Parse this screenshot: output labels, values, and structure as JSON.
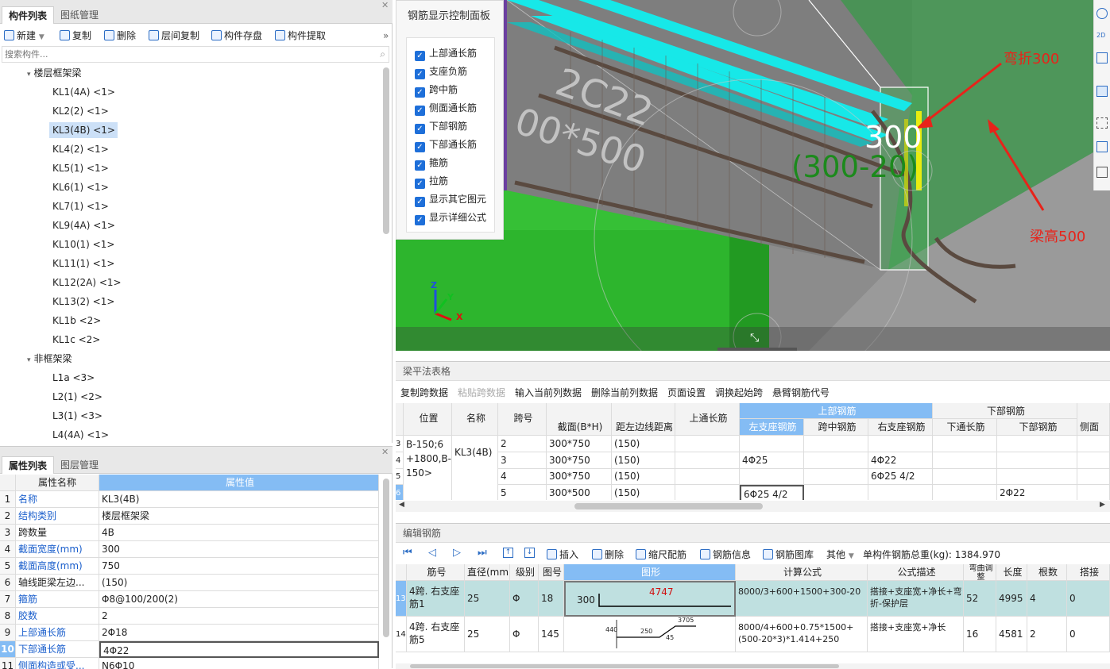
{
  "left_top": {
    "tabs": [
      "构件列表",
      "图纸管理"
    ],
    "toolbar": [
      "新建",
      "复制",
      "删除",
      "层间复制",
      "构件存盘",
      "构件提取"
    ],
    "search_placeholder": "搜索构件...",
    "group1": "楼层框架梁",
    "items1": [
      "KL1(4A) <1>",
      "KL2(2) <1>",
      "KL3(4B) <1>",
      "KL4(2) <1>",
      "KL5(1) <1>",
      "KL6(1) <1>",
      "KL7(1) <1>",
      "KL9(4A) <1>",
      "KL10(1) <1>",
      "KL11(1) <1>",
      "KL12(2A) <1>",
      "KL13(2) <1>",
      "KL1b <2>",
      "KL1c <2>"
    ],
    "group2": "非框架梁",
    "items2": [
      "L1a <3>",
      "L2(1) <2>",
      "L3(1) <3>",
      "L4(4A) <1>"
    ]
  },
  "left_bottom": {
    "tabs": [
      "属性列表",
      "图层管理"
    ],
    "col_name": "属性名称",
    "col_value": "属性值",
    "rows": [
      {
        "n": "1",
        "name": "名称",
        "value": "KL3(4B)",
        "blue": true
      },
      {
        "n": "2",
        "name": "结构类别",
        "value": "楼层框架梁",
        "blue": true
      },
      {
        "n": "3",
        "name": "跨数量",
        "value": "4B",
        "blue": false
      },
      {
        "n": "4",
        "name": "截面宽度(mm)",
        "value": "300",
        "blue": true
      },
      {
        "n": "5",
        "name": "截面高度(mm)",
        "value": "750",
        "blue": true
      },
      {
        "n": "6",
        "name": "轴线距梁左边...",
        "value": "(150)",
        "blue": false
      },
      {
        "n": "7",
        "name": "箍筋",
        "value": "Φ8@100/200(2)",
        "blue": true
      },
      {
        "n": "8",
        "name": "胶数",
        "value": "2",
        "blue": true
      },
      {
        "n": "9",
        "name": "上部通长筋",
        "value": "2Φ18",
        "blue": true
      },
      {
        "n": "10",
        "name": "下部通长筋",
        "value": "4Φ22",
        "blue": true
      },
      {
        "n": "11",
        "name": "侧面构造或受...",
        "value": "N6Φ10",
        "blue": true
      }
    ]
  },
  "panel": {
    "title": "钢筋显示控制面板",
    "checks": [
      "上部通长筋",
      "支座负筋",
      "跨中筋",
      "侧面通长筋",
      "下部钢筋",
      "下部通长筋",
      "箍筋",
      "拉筋",
      "显示其它图元",
      "显示详细公式"
    ]
  },
  "viewport": {
    "annotation_bend": "弯折300",
    "annotation_height": "梁高500",
    "dim_main": "300",
    "dim_formula": "(300-20)",
    "beam_text1": "2C22",
    "beam_text2": "00*500",
    "axis_z": "Z",
    "axis_y": "Y",
    "axis_x": "X"
  },
  "pingfa": {
    "title": "梁平法表格",
    "toolbar": [
      "复制跨数据",
      "粘贴跨数据",
      "输入当前列数据",
      "删除当前列数据",
      "页面设置",
      "调换起始跨",
      "悬臂钢筋代号"
    ],
    "h_position": "位置",
    "h_name": "名称",
    "h_span": "跨号",
    "h_section": "截面(B*H)",
    "h_dist": "距左边线距离",
    "h_top_cont": "上通长筋",
    "h_top": "上部钢筋",
    "h_bottom": "下部钢筋",
    "h_left_support": "左支座钢筋",
    "h_mid": "跨中钢筋",
    "h_right_support": "右支座钢筋",
    "h_bot_cont": "下通长筋",
    "h_bot_steel": "下部钢筋",
    "h_side": "侧面",
    "position_text": "B-150;6+1800,B-150>",
    "name_text": "KL3(4B)",
    "row_nums": [
      "3",
      "4",
      "5",
      "6"
    ],
    "rows": [
      {
        "span": "2",
        "section": "300*750",
        "dist": "(150)",
        "left": "",
        "right": "",
        "bot": ""
      },
      {
        "span": "3",
        "section": "300*750",
        "dist": "(150)",
        "left": "4Φ25",
        "right": "4Φ22",
        "bot": ""
      },
      {
        "span": "4",
        "section": "300*750",
        "dist": "(150)",
        "left": "",
        "right": "6Φ25 4/2",
        "bot": ""
      },
      {
        "span": "5",
        "section": "300*500",
        "dist": "(150)",
        "left": "6Φ25 4/2",
        "right": "",
        "bot": "2Φ22"
      }
    ]
  },
  "edit": {
    "title": "编辑钢筋",
    "toolbar": [
      "插入",
      "删除",
      "缩尺配筋",
      "钢筋信息",
      "钢筋图库",
      "其他"
    ],
    "total_label": "单构件钢筋总重(kg): 1384.970",
    "headers": [
      "筋号",
      "直径(mm)",
      "级别",
      "图号",
      "图形",
      "计算公式",
      "公式描述",
      "弯曲调整",
      "长度",
      "根数",
      "搭接"
    ],
    "rows": [
      {
        "n": "13",
        "name": "4跨. 右支座筋1",
        "dia": "25",
        "grade": "Φ",
        "fig": "18",
        "shape_a": "300",
        "shape_b": "4747",
        "formula": "8000/3+600+1500+300-20",
        "desc": "搭接+支座宽+净长+弯折-保护层",
        "adj": "52",
        "len": "4995",
        "count": "4",
        "lap": "0"
      },
      {
        "n": "14",
        "name": "4跨. 右支座筋5",
        "dia": "25",
        "grade": "Φ",
        "fig": "145",
        "shape_a": "440",
        "shape_b": "250",
        "shape_c": "3705",
        "shape_d": "45",
        "formula": "8000/4+600+0.75*1500+(500-20*3)*1.414+250",
        "desc": "搭接+支座宽+净长",
        "adj": "16",
        "len": "4581",
        "count": "2",
        "lap": "0"
      }
    ]
  }
}
